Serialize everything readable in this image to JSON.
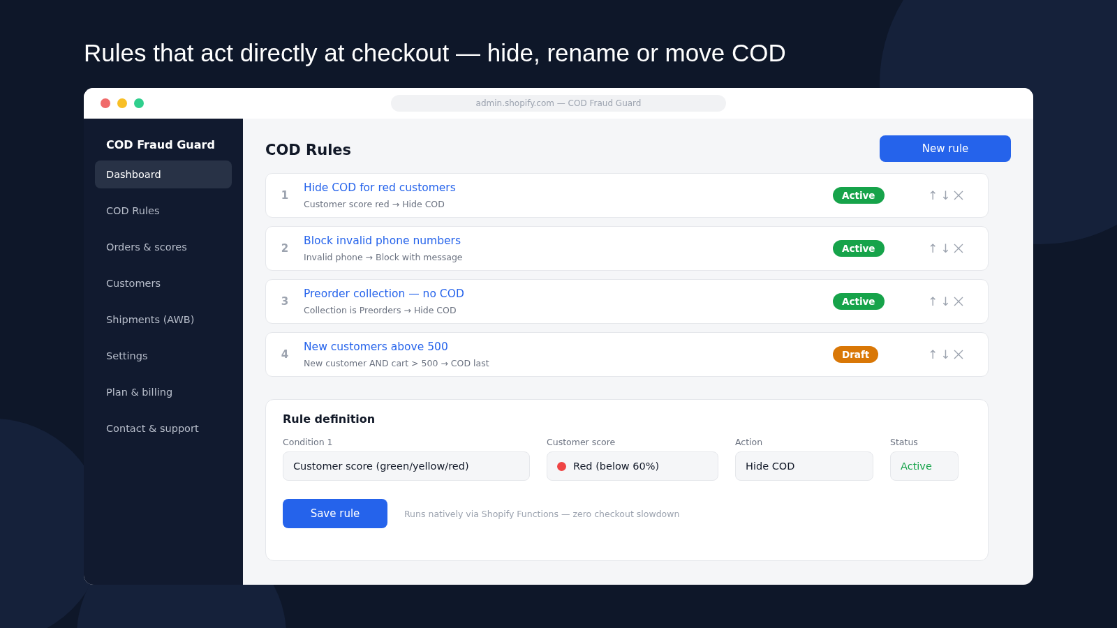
{
  "headline": "Rules that act directly at checkout — hide, rename or move COD",
  "window": {
    "address": "admin.shopify.com — COD Fraud Guard"
  },
  "sidebar": {
    "title": "COD Fraud Guard",
    "items": [
      {
        "label": "Dashboard",
        "selected": true
      },
      {
        "label": "COD Rules",
        "selected": false
      },
      {
        "label": "Orders & scores",
        "selected": false
      },
      {
        "label": "Customers",
        "selected": false
      },
      {
        "label": "Shipments (AWB)",
        "selected": false
      },
      {
        "label": "Settings",
        "selected": false
      },
      {
        "label": "Plan & billing",
        "selected": false
      },
      {
        "label": "Contact & support",
        "selected": false
      }
    ]
  },
  "page": {
    "title": "COD Rules",
    "new_button": "New rule"
  },
  "rules": [
    {
      "number": "1",
      "title": "Hide COD for red customers",
      "summary": "Customer score red → Hide COD",
      "status": "Active",
      "kind": "active",
      "up": "↑",
      "down": "↓"
    },
    {
      "number": "2",
      "title": "Block invalid phone numbers",
      "summary": "Invalid phone → Block with message",
      "status": "Active",
      "kind": "active",
      "up": "↑",
      "down": "↓"
    },
    {
      "number": "3",
      "title": "Preorder collection — no COD",
      "summary": "Collection is Preorders → Hide COD",
      "status": "Active",
      "kind": "active",
      "up": "↑",
      "down": "↓"
    },
    {
      "number": "4",
      "title": "New customers above 500",
      "summary": "New customer AND cart > 500 → COD last",
      "status": "Draft",
      "kind": "draft",
      "up": "↑",
      "down": "↓"
    }
  ],
  "definition": {
    "title": "Rule definition",
    "fields": [
      {
        "label": "Condition 1",
        "value": "Customer score (green/yellow/red)",
        "kind": "text"
      },
      {
        "label": "Customer score",
        "value": "Red (below 60%)",
        "kind": "dot",
        "color": "#ef4444"
      },
      {
        "label": "Action",
        "value": "Hide COD",
        "kind": "text"
      },
      {
        "label": "Status",
        "value": "Active",
        "kind": "status"
      }
    ],
    "save_button": "Save rule",
    "note": "Runs natively via Shopify Functions — zero checkout slowdown"
  }
}
